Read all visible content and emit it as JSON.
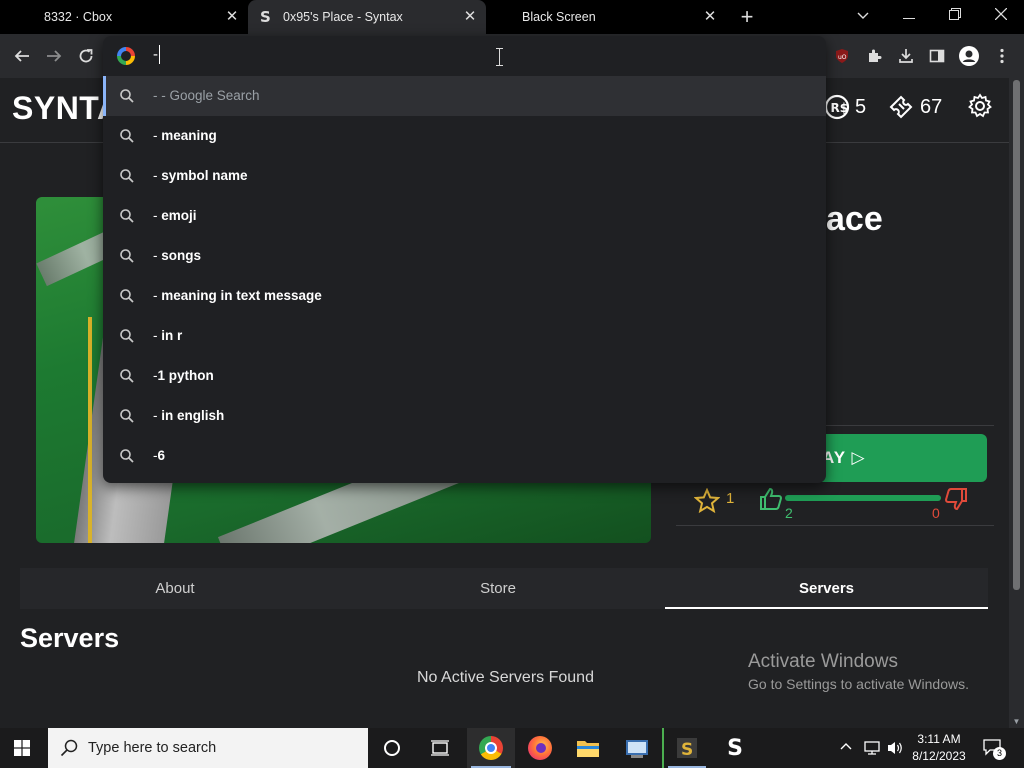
{
  "browser": {
    "tabs": [
      {
        "title": "8332 · Cbox",
        "active": false
      },
      {
        "title": "0x95's Place - Syntax",
        "active": true
      },
      {
        "title": "Black Screen",
        "active": false
      }
    ],
    "omnibox": {
      "value": "-",
      "suggestions": [
        {
          "prefix": "- ",
          "bold": "",
          "muted": "- Google Search",
          "selected": true
        },
        {
          "prefix": "- ",
          "bold": "meaning",
          "muted": "",
          "selected": false
        },
        {
          "prefix": "- ",
          "bold": "symbol name",
          "muted": "",
          "selected": false
        },
        {
          "prefix": "- ",
          "bold": "emoji",
          "muted": "",
          "selected": false
        },
        {
          "prefix": "- ",
          "bold": "songs",
          "muted": "",
          "selected": false
        },
        {
          "prefix": "- ",
          "bold": "meaning in text message",
          "muted": "",
          "selected": false
        },
        {
          "prefix": "- ",
          "bold": "in r",
          "muted": "",
          "selected": false
        },
        {
          "prefix": "-",
          "bold": "1 python",
          "muted": "",
          "selected": false
        },
        {
          "prefix": "- ",
          "bold": "in english",
          "muted": "",
          "selected": false
        },
        {
          "prefix": "-",
          "bold": "6",
          "muted": "",
          "selected": false
        }
      ]
    }
  },
  "site": {
    "brand": "SYNTA",
    "robux": "5",
    "tickets": "67",
    "game_title_partial": "ace",
    "play_label": "AY ▷",
    "favorites": "1",
    "upvotes": "2",
    "downvotes": "0",
    "upvote_fraction": 1.0,
    "tabs": [
      "About",
      "Store",
      "Servers"
    ],
    "active_tab": "Servers",
    "section_heading": "Servers",
    "empty_message": "No Active Servers Found",
    "watermark": {
      "line1": "Activate Windows",
      "line2": "Go to Settings to activate Windows."
    }
  },
  "taskbar": {
    "search_placeholder": "Type here to search",
    "time": "3:11 AM",
    "date": "8/12/2023",
    "notifications": "3"
  },
  "colors": {
    "accent_green": "#1f9d55",
    "star": "#e0b43a",
    "downvote": "#e04a3a"
  }
}
